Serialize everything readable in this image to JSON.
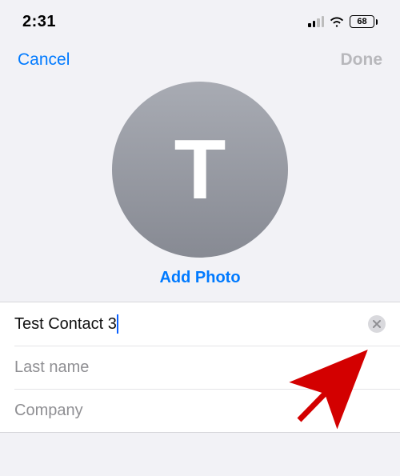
{
  "status": {
    "time": "2:31",
    "battery": "68"
  },
  "nav": {
    "cancel": "Cancel",
    "done": "Done"
  },
  "avatar": {
    "letter": "T",
    "add_photo": "Add Photo"
  },
  "fields": {
    "first_name_value": "Test Contact 3",
    "last_name_placeholder": "Last name",
    "company_placeholder": "Company"
  }
}
